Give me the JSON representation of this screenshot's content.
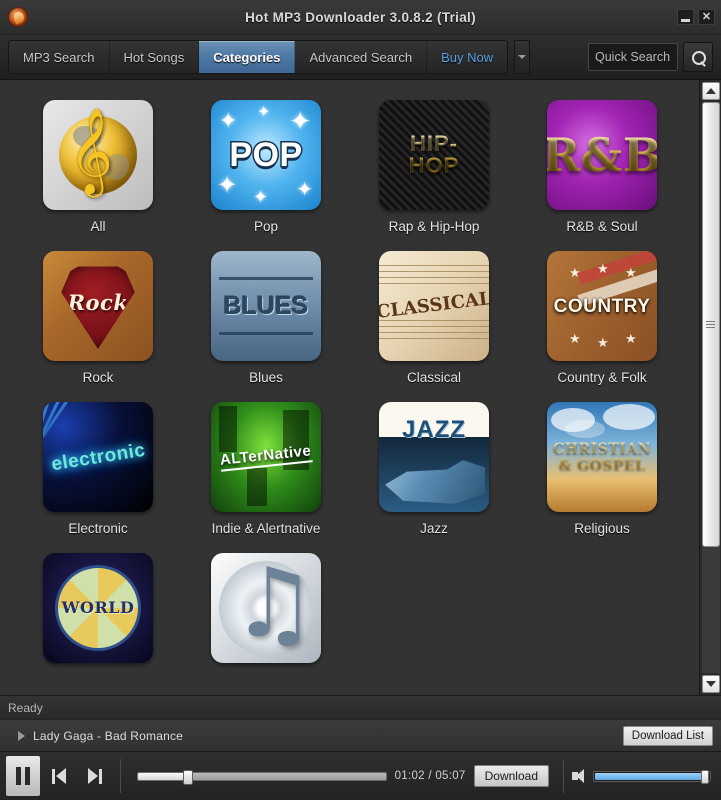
{
  "window": {
    "title": "Hot MP3 Downloader  3.0.8.2  (Trial)",
    "app_icon": "flame-logo-icon",
    "minimize_label": "–",
    "close_label": "✕",
    "accent_color": "#4e7aa6",
    "link_color": "#5aa0e6"
  },
  "toolbar": {
    "tabs": [
      {
        "label": "MP3 Search",
        "active": false,
        "style": "normal"
      },
      {
        "label": "Hot Songs",
        "active": false,
        "style": "normal"
      },
      {
        "label": "Categories",
        "active": true,
        "style": "normal"
      },
      {
        "label": "Advanced Search",
        "active": false,
        "style": "normal"
      },
      {
        "label": "Buy Now",
        "active": false,
        "style": "link"
      }
    ],
    "dropdown_icon": "chevron-down-icon",
    "quick_search": {
      "placeholder": "Quick Search",
      "value": ""
    },
    "search_icon": "search-icon"
  },
  "categories": [
    {
      "label": "All",
      "art": "t-all",
      "art_text": ""
    },
    {
      "label": "Pop",
      "art": "t-pop",
      "art_text": "POP"
    },
    {
      "label": "Rap & Hip-Hop",
      "art": "t-hiphop",
      "art_text": "HIP-\nHOP"
    },
    {
      "label": "R&B & Soul",
      "art": "t-rnb",
      "art_text": "R&B"
    },
    {
      "label": "Rock",
      "art": "t-rock",
      "art_text": "Rock"
    },
    {
      "label": "Blues",
      "art": "t-blues",
      "art_text": "BLUES"
    },
    {
      "label": "Classical",
      "art": "t-classical",
      "art_text": "CLASSICAL"
    },
    {
      "label": "Country & Folk",
      "art": "t-country",
      "art_text": "COUNTRY"
    },
    {
      "label": "Electronic",
      "art": "t-electronic",
      "art_text": "electronic"
    },
    {
      "label": "Indie & Alertnative",
      "art": "t-indie",
      "art_text": "ALTerNative"
    },
    {
      "label": "Jazz",
      "art": "t-jazz",
      "art_text": "JAZZ"
    },
    {
      "label": "Religious",
      "art": "t-religious",
      "art_text": "CHRISTIAN\n& GOSPEL"
    },
    {
      "label": "",
      "art": "t-world",
      "art_text": "WORLD"
    },
    {
      "label": "",
      "art": "t-note",
      "art_text": ""
    }
  ],
  "scrollbar": {
    "up_icon": "scroll-up-arrow-icon",
    "down_icon": "scroll-down-arrow-icon",
    "thumb_grip_icon": "grip-icon"
  },
  "statusbar": {
    "text": "Ready"
  },
  "nowplaying": {
    "expander_icon": "play-triangle-icon",
    "track": "Lady Gaga - Bad Romance",
    "download_list_label": "Download List"
  },
  "player": {
    "pause_icon": "pause-icon",
    "prev_icon": "previous-track-icon",
    "next_icon": "next-track-icon",
    "seek_percent": 20,
    "time": "01:02 / 05:07",
    "download_label": "Download",
    "volume_icon": "speaker-icon",
    "volume_percent": 97
  }
}
